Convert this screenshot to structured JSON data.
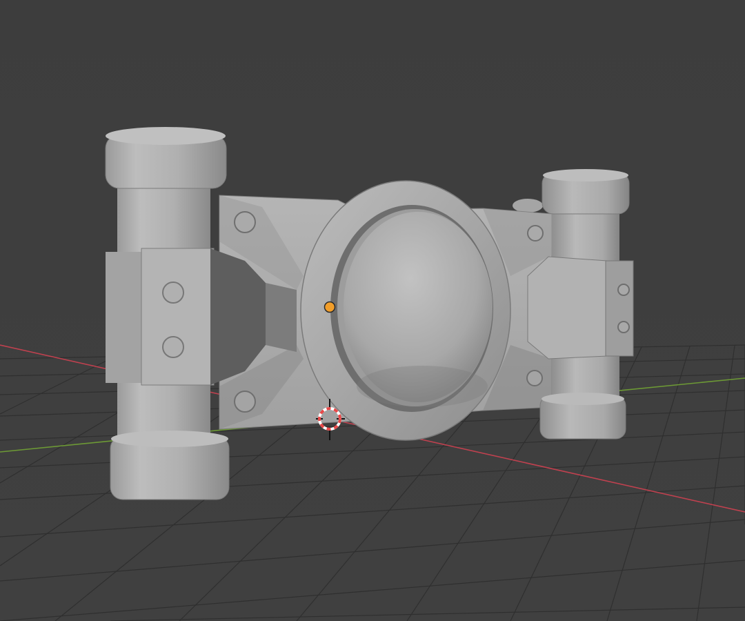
{
  "viewport": {
    "background_top": "#3d3d3d",
    "background_bottom": "#404040",
    "grid_color": "#2f2f2f",
    "x_axis_color": "#c0414f",
    "y_axis_color": "#6d9a35"
  },
  "object": {
    "type": "mesh",
    "shading": "solid",
    "base_color": "#b4b4b4",
    "shadow_color": "#5a5a5a",
    "origin_color": "#f29e2a"
  },
  "cursor": {
    "icon": "3d-cursor-icon",
    "ring_colors": [
      "#e84848",
      "#ffffff"
    ]
  }
}
